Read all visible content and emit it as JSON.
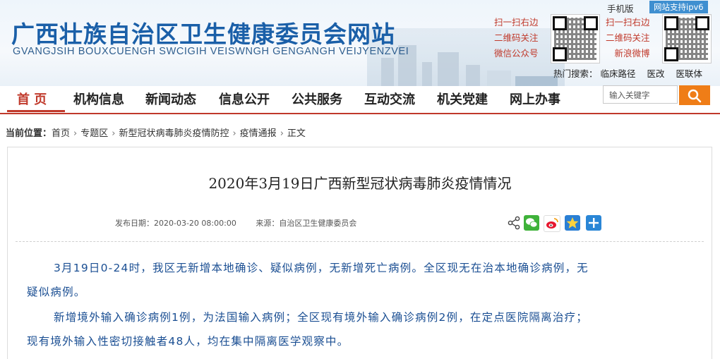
{
  "header": {
    "title": "广西壮族自治区卫生健康委员会网站",
    "subtitle": "GVANGJSIH BOUXCUENGH SWCIGIH VEISWNGH GENGANGH VEIJYENZVEI",
    "mobile_label": "手机版",
    "ipv6_label": "网站支持ipv6",
    "qr_wechat": [
      "扫一扫右边",
      "二维码关注",
      "微信公众号"
    ],
    "qr_weibo": [
      "扫一扫右边",
      "二维码关注",
      "新浪微博"
    ],
    "hot_label": "热门搜索：",
    "hot_terms": [
      "临床路径",
      "医改",
      "医联体"
    ]
  },
  "nav": {
    "items": [
      "首 页",
      "机构信息",
      "新闻动态",
      "信息公开",
      "公共服务",
      "互动交流",
      "机关党建",
      "网上办事"
    ],
    "search_placeholder": "输入关键字"
  },
  "breadcrumb": {
    "label": "当前位置：",
    "items": [
      "首页",
      "专题区",
      "新型冠状病毒肺炎疫情防控",
      "疫情通报",
      "正文"
    ]
  },
  "article": {
    "title": "2020年3月19日广西新型冠状病毒肺炎疫情情况",
    "date": "发布日期：2020-03-20 08:00:00",
    "source": "来源：自治区卫生健康委员会",
    "lines": [
      "3月19日0-24时，我区无新增本地确诊、疑似病例，无新增死亡病例。全区现无在治本地确诊病例，无",
      "疑似病例。",
      "新增境外输入确诊病例1例，为法国输入病例；全区现有境外输入确诊病例2例，在定点医院隔离治疗；",
      "现有境外输入性密切接触者48人，均在集中隔离医学观察中。"
    ]
  },
  "share_icons": [
    "share-icon",
    "wechat-icon",
    "weibo-icon",
    "qzone-star-icon",
    "more-plus-icon"
  ],
  "colors": {
    "brand_blue": "#1a5fa8",
    "nav_red": "#c0392b",
    "search_orange": "#ef7d17",
    "text_blue": "#1b4f93"
  }
}
